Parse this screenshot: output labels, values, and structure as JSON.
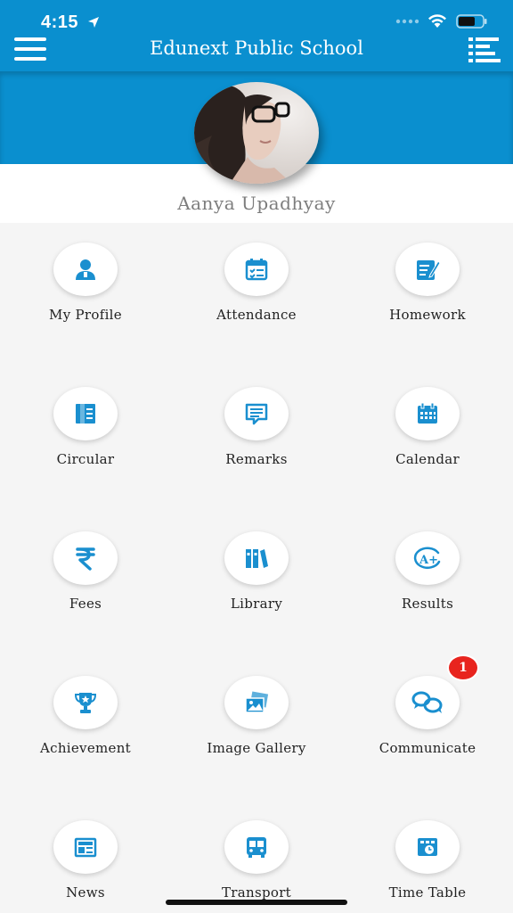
{
  "status_bar": {
    "time": "4:15"
  },
  "header": {
    "title": "Edunext Public School"
  },
  "profile": {
    "name": "Aanya Upadhyay"
  },
  "colors": {
    "primary": "#0a8fcf",
    "icon": "#1a8fcf",
    "badge": "#e8241e"
  },
  "menu": [
    {
      "label": "My Profile",
      "icon": "person-icon"
    },
    {
      "label": "Attendance",
      "icon": "attendance-icon"
    },
    {
      "label": "Homework",
      "icon": "homework-icon"
    },
    {
      "label": "Circular",
      "icon": "circular-icon"
    },
    {
      "label": "Remarks",
      "icon": "remarks-icon"
    },
    {
      "label": "Calendar",
      "icon": "calendar-icon"
    },
    {
      "label": "Fees",
      "icon": "rupee-icon"
    },
    {
      "label": "Library",
      "icon": "library-icon"
    },
    {
      "label": "Results",
      "icon": "results-icon"
    },
    {
      "label": "Achievement",
      "icon": "trophy-icon"
    },
    {
      "label": "Image Gallery",
      "icon": "gallery-icon"
    },
    {
      "label": "Communicate",
      "icon": "chat-icon",
      "badge": "1"
    },
    {
      "label": "News",
      "icon": "news-icon"
    },
    {
      "label": "Transport",
      "icon": "bus-icon"
    },
    {
      "label": "Time Table",
      "icon": "timetable-icon"
    }
  ]
}
